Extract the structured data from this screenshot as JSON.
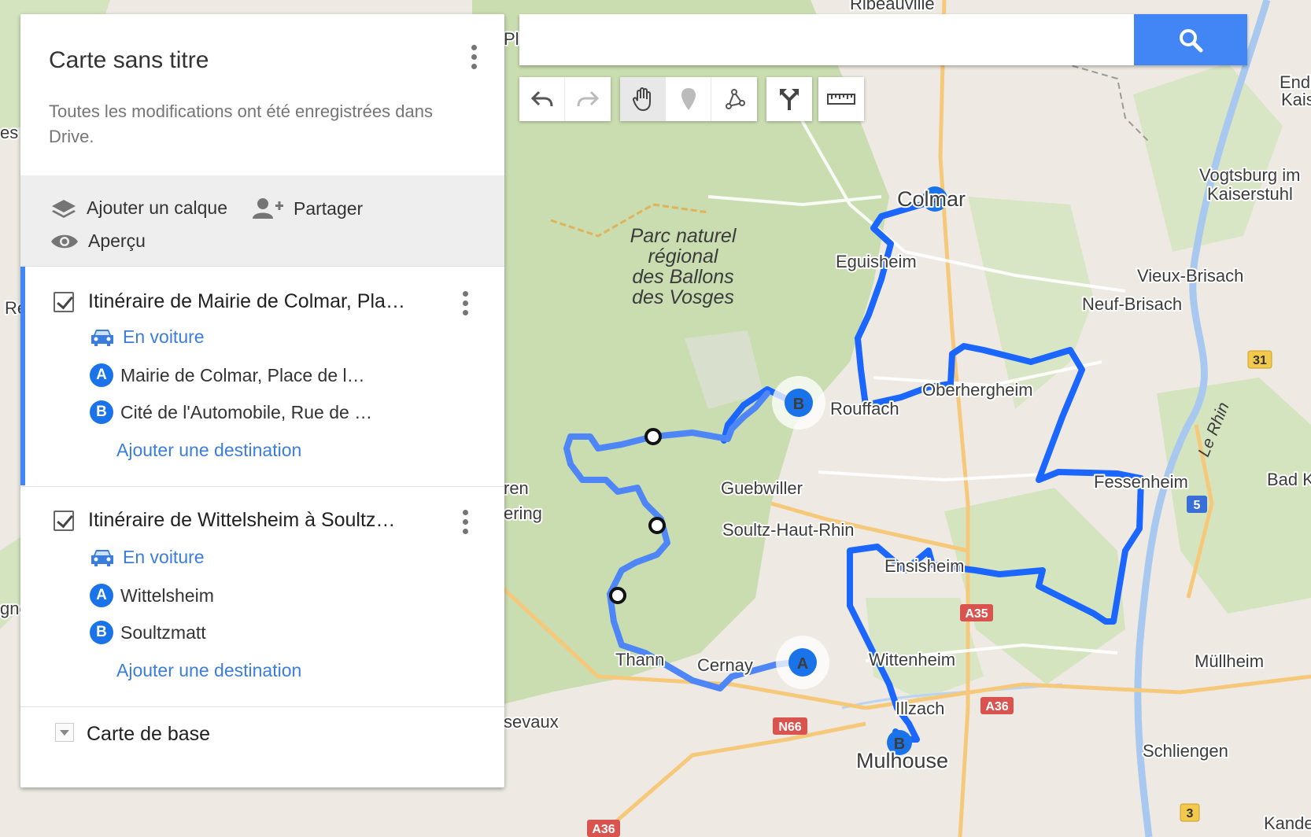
{
  "map": {
    "places": {
      "colmar": "Colmar",
      "eguisheim": "Eguisheim",
      "rouffach": "Rouffach",
      "oberhergheim": "Oberhergheim",
      "guebwiller": "Guebwiller",
      "soultz": "Soultz-Haut-Rhin",
      "ensisheim": "Ensisheim",
      "fessenheim": "Fessenheim",
      "wittenheim": "Wittenheim",
      "illzach": "Illzach",
      "mulhouse": "Mulhouse",
      "cernay": "Cernay",
      "thann": "Thann",
      "mullheim": "Müllheim",
      "schliengen": "Schliengen",
      "vieux_brisach": "Vieux-Brisach",
      "neuf_brisach": "Neuf-Brisach",
      "vogtsburg_1": "Vogtsburg im",
      "vogtsburg_2": "Kaiserstuhl",
      "ribeauville": "Ribeauvillé",
      "bad_k": "Bad K",
      "kandern": "Kandern",
      "endi": "Endi",
      "kais": "Kais",
      "masevaux": "sevaux",
      "plai": "Plai",
      "ren": "ren",
      "ering": "ering",
      "gne": "gne",
      "re": "Re",
      "es": "es",
      "rhin": "Le Rhin",
      "park": [
        "Parc naturel",
        "régional",
        "des Ballons",
        "des Vosges"
      ]
    },
    "roads": {
      "a35": "A35",
      "a36_1": "A36",
      "a36_2": "A36",
      "n66": "N66",
      "r31": "31",
      "r5": "5",
      "r3": "3"
    },
    "markers": {
      "a": "A",
      "b": "B"
    }
  },
  "panel": {
    "title": "Carte sans titre",
    "subtitle": "Toutes les modifications ont été enregistrées dans Drive.",
    "actions": {
      "add_layer": "Ajouter un calque",
      "share": "Partager",
      "preview": "Aperçu"
    },
    "layers": [
      {
        "title": "Itinéraire de Mairie de Colmar, Pla…",
        "mode": "En voiture",
        "stops": [
          {
            "letter": "A",
            "label": "Mairie de Colmar, Place de l…"
          },
          {
            "letter": "B",
            "label": "Cité de l'Automobile, Rue de …"
          }
        ],
        "add_destination": "Ajouter une destination"
      },
      {
        "title": "Itinéraire de Wittelsheim à Soultz…",
        "mode": "En voiture",
        "stops": [
          {
            "letter": "A",
            "label": "Wittelsheim"
          },
          {
            "letter": "B",
            "label": "Soultzmatt"
          }
        ],
        "add_destination": "Ajouter une destination"
      }
    ],
    "base_map": "Carte de base"
  },
  "search": {
    "value": "",
    "placeholder": ""
  },
  "colors": {
    "route": "#1a66ff",
    "accent": "#4285f4",
    "forest": "#c9ddb0",
    "land": "#eeeae3"
  }
}
